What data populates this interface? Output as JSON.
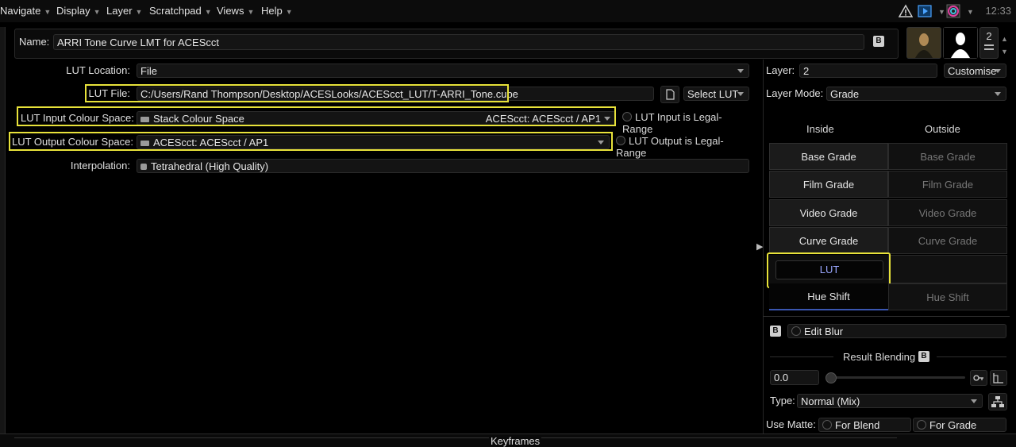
{
  "menu": [
    {
      "label": "Navigate"
    },
    {
      "label": "Display"
    },
    {
      "label": "Layer"
    },
    {
      "label": "Scratchpad"
    },
    {
      "label": "Views"
    },
    {
      "label": "Help"
    }
  ],
  "clock": "12:33",
  "name": {
    "label": "Name:",
    "value": "ARRI Tone Curve LMT for ACEScct",
    "b_badge": "B"
  },
  "version_count": "2",
  "lut": {
    "location_label": "LUT Location:",
    "location_value": "File",
    "file_label": "LUT File:",
    "file_value": "C:/Users/Rand Thompson/Desktop/ACESLooks/ACEScct_LUT/T-ARRI_Tone.cube",
    "select_label": "Select LUT",
    "input_label": "LUT Input Colour Space:",
    "input_value": "Stack Colour Space",
    "input_right": "ACEScct: ACEScct / AP1",
    "input_legal": "LUT Input is Legal-Range",
    "output_label": "LUT Output Colour Space:",
    "output_value": "ACEScct: ACEScct / AP1",
    "output_legal": "LUT Output is Legal-Range",
    "interp_label": "Interpolation:",
    "interp_value": "Tetrahedral (High Quality)"
  },
  "right": {
    "layer_label": "Layer:",
    "layer_value": "2",
    "customise": "Customise",
    "mode_label": "Layer Mode:",
    "mode_value": "Grade",
    "inside": "Inside",
    "outside": "Outside",
    "rows": [
      {
        "inside": "Base Grade",
        "outside": "Base Grade"
      },
      {
        "inside": "Film Grade",
        "outside": "Film Grade"
      },
      {
        "inside": "Video Grade",
        "outside": "Video Grade"
      },
      {
        "inside": "Curve Grade",
        "outside": "Curve Grade"
      },
      {
        "inside": "LUT",
        "outside": ""
      },
      {
        "inside": "Hue Shift",
        "outside": "Hue Shift"
      }
    ],
    "edit_blur": "Edit Blur",
    "b_badge": "B",
    "result_blending": "Result Blending",
    "blend_value": "0.0",
    "type_label": "Type:",
    "type_value": "Normal (Mix)",
    "use_matte": "Use Matte:",
    "for_blend": "For Blend",
    "for_grade": "For Grade"
  },
  "keyframes": "Keyframes",
  "colors": {
    "highlight": "#e8e23a",
    "lut_text": "#9aa7ff"
  }
}
